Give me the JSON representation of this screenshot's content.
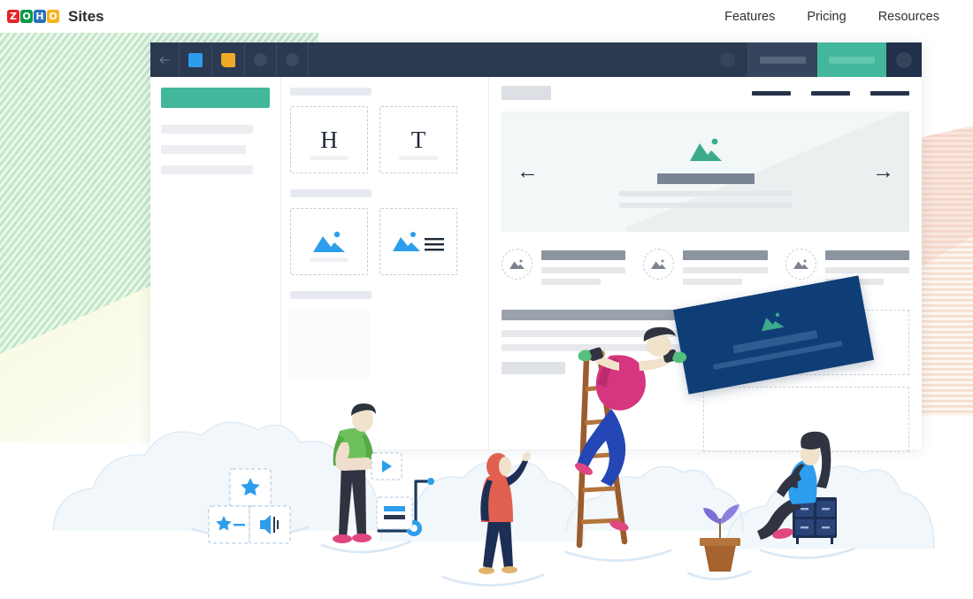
{
  "header": {
    "brand": {
      "logo_letters": [
        "Z",
        "O",
        "H",
        "O"
      ],
      "product": "Sites"
    },
    "nav": [
      {
        "label": "Features"
      },
      {
        "label": "Pricing"
      },
      {
        "label": "Resources"
      }
    ]
  },
  "colors": {
    "brand_red": "#e42527",
    "brand_green": "#089949",
    "brand_blue": "#2970b8",
    "brand_yellow": "#f9b21d",
    "toolbar_navy": "#2b3a50",
    "accent_teal": "#42b79b",
    "card_navy": "#0f3e77",
    "icon_blue": "#2d9ded"
  },
  "app": {
    "toolbar": {
      "back_icon": "arrow-left-icon",
      "tool_square_icon": "blue-square-icon",
      "tool_page_icon": "orange-page-icon",
      "dot_icons": [
        "circle-icon",
        "circle-icon"
      ],
      "account_icon": "circle-avatar-icon",
      "preview_label": "",
      "publish_label": "",
      "end_icon": "circle-avatar-icon"
    },
    "sidebar": {
      "primary_button_label": "",
      "placeholder_rows": 3
    },
    "widgets": {
      "sections": [
        {
          "label": "",
          "cards": [
            {
              "glyph": "H",
              "name": "heading-widget"
            },
            {
              "glyph": "T",
              "name": "text-widget"
            }
          ]
        },
        {
          "label": "",
          "cards": [
            {
              "glyph": "",
              "name": "image-widget"
            },
            {
              "glyph": "",
              "name": "image-text-widget"
            }
          ]
        },
        {
          "label": "",
          "cards": [
            {
              "glyph": "",
              "name": "blank-widget"
            }
          ]
        }
      ]
    },
    "canvas": {
      "site_logo": "",
      "menu_items": [
        "",
        "",
        ""
      ],
      "hero": {
        "image_icon": "mountain-image-icon",
        "title_bar": "",
        "sub_bars": [
          "",
          ""
        ],
        "prev_arrow": "←",
        "next_arrow": "→"
      },
      "columns": [
        {
          "icon": "mountain-image-icon",
          "heading": "",
          "lines": [
            "",
            ""
          ]
        },
        {
          "icon": "mountain-image-icon",
          "heading": "",
          "lines": [
            "",
            ""
          ]
        },
        {
          "icon": "mountain-image-icon",
          "heading": "",
          "lines": [
            "",
            ""
          ]
        }
      ],
      "lower_left": {
        "heading": "",
        "lines": [
          "",
          ""
        ],
        "block": ""
      },
      "drop_zones": 2
    },
    "drag_card": {
      "image_icon": "mountain-image-icon",
      "bars": [
        "",
        ""
      ]
    }
  },
  "illustration": {
    "figures": [
      {
        "name": "person-green-shirt",
        "description": "person holding video widget"
      },
      {
        "name": "person-pink-shirt-on-ladder",
        "description": "person on ladder placing card"
      },
      {
        "name": "person-coral-coat",
        "description": "person with raised arm"
      },
      {
        "name": "person-seated-on-cabinet",
        "description": "person sitting on file cabinet"
      }
    ],
    "widget_cards": [
      {
        "name": "star-widget-card",
        "icon": "star-icon"
      },
      {
        "name": "rating-widget-card",
        "icon": "star-rating-icon"
      },
      {
        "name": "audio-widget-card",
        "icon": "speaker-icon"
      },
      {
        "name": "video-widget-card",
        "icon": "play-icon"
      },
      {
        "name": "form-widget-card",
        "icon": "form-icon"
      }
    ],
    "props": [
      {
        "name": "potted-plant",
        "icon": "plant-icon"
      },
      {
        "name": "cart",
        "icon": "cart-icon"
      },
      {
        "name": "file-cabinet",
        "icon": "cabinet-icon"
      }
    ]
  }
}
